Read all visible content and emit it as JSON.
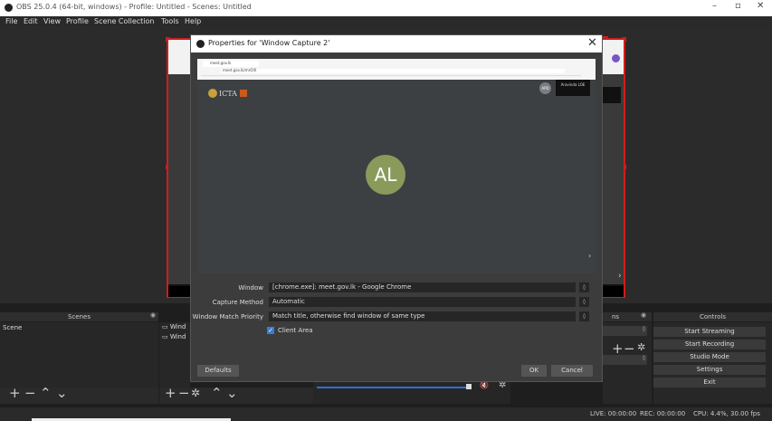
{
  "window": {
    "title": "OBS 25.0.4 (64-bit, windows) - Profile: Untitled - Scenes: Untitled",
    "minimize_icon": "–",
    "maximize_icon": "▫",
    "close_icon": "✕"
  },
  "menu": [
    "File",
    "Edit",
    "View",
    "Profile",
    "Scene Collection",
    "Tools",
    "Help"
  ],
  "docks": {
    "scenes": {
      "header": "Scenes",
      "items": [
        "Scene"
      ]
    },
    "sources": {
      "items": [
        "Wind",
        "Wind"
      ]
    },
    "transitions": {
      "header": "ns"
    },
    "controls": {
      "header": "Controls",
      "buttons": [
        "Start Streaming",
        "Start Recording",
        "Studio Mode",
        "Settings",
        "Exit"
      ]
    }
  },
  "status": {
    "live": "LIVE: 00:00:00",
    "rec": "REC: 00:00:00",
    "cpu": "CPU: 4.4%, 30.00 fps"
  },
  "dialog": {
    "title": "Properties for 'Window Capture 2'",
    "close_icon": "✕",
    "preview": {
      "tab_title": "meet.gov.lk",
      "url": "meet.gov.lk/mrOIX",
      "org_logo_text": "ICTA",
      "avatar_initials": "AL",
      "participant_tile": "Aravinda LOE",
      "participant_badge": "APD",
      "next_arrow": "›"
    },
    "fields": {
      "window_label": "Window",
      "window_value": "[chrome.exe]: meet.gov.lk - Google Chrome",
      "capture_method_label": "Capture Method",
      "capture_method_value": "Automatic",
      "match_priority_label": "Window Match Priority",
      "match_priority_value": "Match title, otherwise find window of same type",
      "client_area_label": "Client Area",
      "client_area_checked": true
    },
    "buttons": {
      "defaults": "Defaults",
      "ok": "OK",
      "cancel": "Cancel"
    }
  },
  "colors": {
    "selection_red": "#d01c1c",
    "avatar_green": "#8a9a5b",
    "accent_blue": "#2f6fd6",
    "checkbox_blue": "#3a7bd5"
  }
}
